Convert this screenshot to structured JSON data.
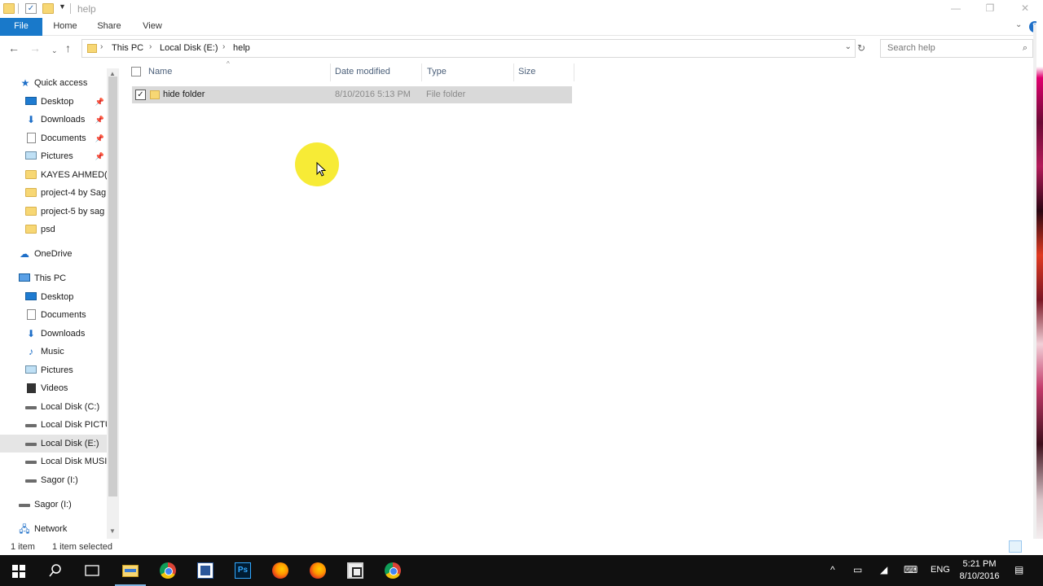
{
  "window": {
    "title": "help"
  },
  "ribbon": {
    "tabs": [
      "File",
      "Home",
      "Share",
      "View"
    ]
  },
  "address": {
    "crumbs": [
      "This PC",
      "Local Disk (E:)",
      "help"
    ],
    "search_placeholder": "Search help"
  },
  "nav": {
    "quick_access": "Quick access",
    "quick_items": [
      "Desktop",
      "Downloads",
      "Documents",
      "Pictures",
      "KAYES AHMED(\\",
      "project-4 by Sag",
      "project-5 by sag",
      "psd"
    ],
    "onedrive": "OneDrive",
    "this_pc": "This PC",
    "pc_items": [
      "Desktop",
      "Documents",
      "Downloads",
      "Music",
      "Pictures",
      "Videos",
      "Local Disk (C:)",
      "Local Disk PICTU",
      "Local Disk (E:)",
      "Local Disk MUSI(",
      "Sagor (I:)"
    ],
    "sagor": "Sagor (I:)",
    "network": "Network",
    "selected": "Local Disk (E:)"
  },
  "columns": {
    "name": "Name",
    "date": "Date modified",
    "type": "Type",
    "size": "Size"
  },
  "files": [
    {
      "name": "hide folder",
      "date": "8/10/2016 5:13 PM",
      "type": "File folder",
      "size": "",
      "selected": true
    }
  ],
  "status": {
    "count": "1 item",
    "selection": "1 item selected"
  },
  "taskbar": {
    "lang": "ENG",
    "time": "5:21 PM",
    "date": "8/10/2016"
  },
  "colors": {
    "accent": "#1979ca",
    "highlight": "#f7ea2b",
    "taskbar": "#101010"
  }
}
